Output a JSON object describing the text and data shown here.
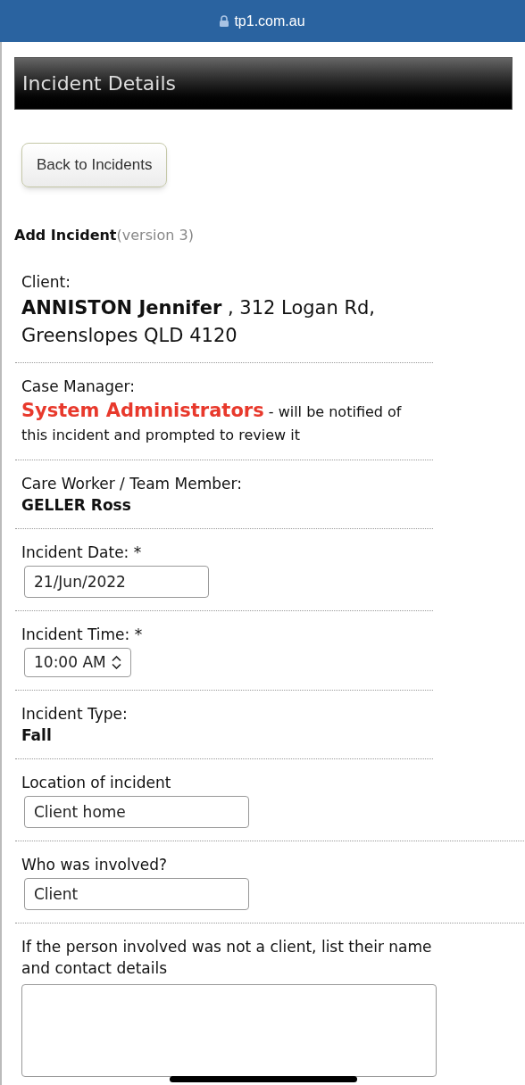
{
  "browser": {
    "url": "tp1.com.au"
  },
  "header": {
    "title": "Incident Details"
  },
  "back_button": {
    "label": "Back to Incidents"
  },
  "form_title": {
    "title": "Add Incident",
    "version": "(version 3)"
  },
  "sections": [
    {
      "kind": "client",
      "label": "Client:",
      "value": "**ANNISTON Jennifer** , 312 Logan Rd, Greenslopes QLD 4120"
    },
    {
      "kind": "manager",
      "label": "Case Manager:",
      "value": "System Administrators",
      "note": "- will be notified of this incident and prompted to review it"
    },
    {
      "kind": "info",
      "label": "Care Worker / Team Member:",
      "value": "GELLER Ross"
    },
    {
      "kind": "date",
      "label": "Incident Date: *",
      "value": "21/Jun/2022"
    },
    {
      "kind": "select",
      "label": "Incident Time: *",
      "value": "10:00 AM"
    },
    {
      "kind": "info",
      "label": "Incident Type:",
      "value": "Fall"
    },
    {
      "kind": "text",
      "label": "Location of incident",
      "value": "Client home"
    },
    {
      "kind": "text",
      "label": "Who was involved?",
      "value": "Client"
    },
    {
      "kind": "textarea",
      "label": "If the person involved was not a client, list their name and contact details"
    }
  ]
}
